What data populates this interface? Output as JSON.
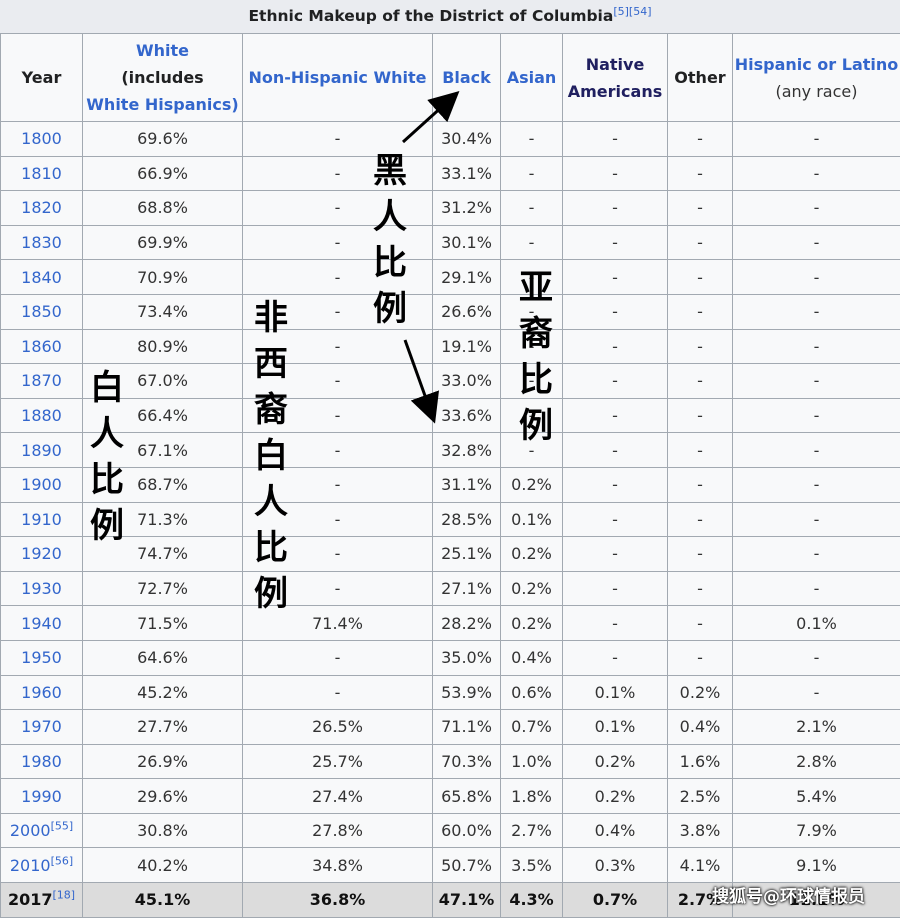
{
  "caption": {
    "title": "Ethnic Makeup of the District of Columbia",
    "refs": "[5][54]"
  },
  "headers": {
    "year": "Year",
    "white_line1": "White",
    "white_line2": "(includes",
    "white_line3": "White Hispanics)",
    "non_hispanic_white": "Non-Hispanic White",
    "black": "Black",
    "asian": "Asian",
    "native_line1": "Native",
    "native_line2": "Americans",
    "other": "Other",
    "hispanic_line1": "Hispanic or Latino",
    "hispanic_line2": "(any race)"
  },
  "rows": [
    {
      "year": "1800",
      "ref": "",
      "white": "69.6%",
      "nhw": "-",
      "black": "30.4%",
      "asian": "-",
      "native": "-",
      "other": "-",
      "hispanic": "-"
    },
    {
      "year": "1810",
      "ref": "",
      "white": "66.9%",
      "nhw": "-",
      "black": "33.1%",
      "asian": "-",
      "native": "-",
      "other": "-",
      "hispanic": "-"
    },
    {
      "year": "1820",
      "ref": "",
      "white": "68.8%",
      "nhw": "-",
      "black": "31.2%",
      "asian": "-",
      "native": "-",
      "other": "-",
      "hispanic": "-"
    },
    {
      "year": "1830",
      "ref": "",
      "white": "69.9%",
      "nhw": "-",
      "black": "30.1%",
      "asian": "-",
      "native": "-",
      "other": "-",
      "hispanic": "-"
    },
    {
      "year": "1840",
      "ref": "",
      "white": "70.9%",
      "nhw": "-",
      "black": "29.1%",
      "asian": "-",
      "native": "-",
      "other": "-",
      "hispanic": "-"
    },
    {
      "year": "1850",
      "ref": "",
      "white": "73.4%",
      "nhw": "-",
      "black": "26.6%",
      "asian": "-",
      "native": "-",
      "other": "-",
      "hispanic": "-"
    },
    {
      "year": "1860",
      "ref": "",
      "white": "80.9%",
      "nhw": "-",
      "black": "19.1%",
      "asian": "-",
      "native": "-",
      "other": "-",
      "hispanic": "-"
    },
    {
      "year": "1870",
      "ref": "",
      "white": "67.0%",
      "nhw": "-",
      "black": "33.0%",
      "asian": "-",
      "native": "-",
      "other": "-",
      "hispanic": "-"
    },
    {
      "year": "1880",
      "ref": "",
      "white": "66.4%",
      "nhw": "-",
      "black": "33.6%",
      "asian": "-",
      "native": "-",
      "other": "-",
      "hispanic": "-"
    },
    {
      "year": "1890",
      "ref": "",
      "white": "67.1%",
      "nhw": "-",
      "black": "32.8%",
      "asian": "-",
      "native": "-",
      "other": "-",
      "hispanic": "-"
    },
    {
      "year": "1900",
      "ref": "",
      "white": "68.7%",
      "nhw": "-",
      "black": "31.1%",
      "asian": "0.2%",
      "native": "-",
      "other": "-",
      "hispanic": "-"
    },
    {
      "year": "1910",
      "ref": "",
      "white": "71.3%",
      "nhw": "-",
      "black": "28.5%",
      "asian": "0.1%",
      "native": "-",
      "other": "-",
      "hispanic": "-"
    },
    {
      "year": "1920",
      "ref": "",
      "white": "74.7%",
      "nhw": "-",
      "black": "25.1%",
      "asian": "0.2%",
      "native": "-",
      "other": "-",
      "hispanic": "-"
    },
    {
      "year": "1930",
      "ref": "",
      "white": "72.7%",
      "nhw": "-",
      "black": "27.1%",
      "asian": "0.2%",
      "native": "-",
      "other": "-",
      "hispanic": "-"
    },
    {
      "year": "1940",
      "ref": "",
      "white": "71.5%",
      "nhw": "71.4%",
      "black": "28.2%",
      "asian": "0.2%",
      "native": "-",
      "other": "-",
      "hispanic": "0.1%"
    },
    {
      "year": "1950",
      "ref": "",
      "white": "64.6%",
      "nhw": "-",
      "black": "35.0%",
      "asian": "0.4%",
      "native": "-",
      "other": "-",
      "hispanic": "-"
    },
    {
      "year": "1960",
      "ref": "",
      "white": "45.2%",
      "nhw": "-",
      "black": "53.9%",
      "asian": "0.6%",
      "native": "0.1%",
      "other": "0.2%",
      "hispanic": "-"
    },
    {
      "year": "1970",
      "ref": "",
      "white": "27.7%",
      "nhw": "26.5%",
      "black": "71.1%",
      "asian": "0.7%",
      "native": "0.1%",
      "other": "0.4%",
      "hispanic": "2.1%"
    },
    {
      "year": "1980",
      "ref": "",
      "white": "26.9%",
      "nhw": "25.7%",
      "black": "70.3%",
      "asian": "1.0%",
      "native": "0.2%",
      "other": "1.6%",
      "hispanic": "2.8%"
    },
    {
      "year": "1990",
      "ref": "",
      "white": "29.6%",
      "nhw": "27.4%",
      "black": "65.8%",
      "asian": "1.8%",
      "native": "0.2%",
      "other": "2.5%",
      "hispanic": "5.4%"
    },
    {
      "year": "2000",
      "ref": "[55]",
      "white": "30.8%",
      "nhw": "27.8%",
      "black": "60.0%",
      "asian": "2.7%",
      "native": "0.4%",
      "other": "3.8%",
      "hispanic": "7.9%"
    },
    {
      "year": "2010",
      "ref": "[56]",
      "white": "40.2%",
      "nhw": "34.8%",
      "black": "50.7%",
      "asian": "3.5%",
      "native": "0.3%",
      "other": "4.1%",
      "hispanic": "9.1%"
    }
  ],
  "total_row": {
    "year": "2017",
    "ref": "[18]",
    "white": "45.1%",
    "nhw": "36.8%",
    "black": "47.1%",
    "asian": "4.3%",
    "native": "0.7%",
    "other": "2.7%",
    "hispanic": "11.1%"
  },
  "annotations": {
    "black_label": [
      "黑",
      "人",
      "比",
      "例"
    ],
    "asian_label": [
      "亚",
      "裔",
      "比",
      "例"
    ],
    "white_label": [
      "白",
      "人",
      "比",
      "例"
    ],
    "nhw_label": [
      "非",
      "西",
      "裔",
      "白",
      "人",
      "比",
      "例"
    ]
  },
  "watermark": "搜狐号@环球情报员"
}
